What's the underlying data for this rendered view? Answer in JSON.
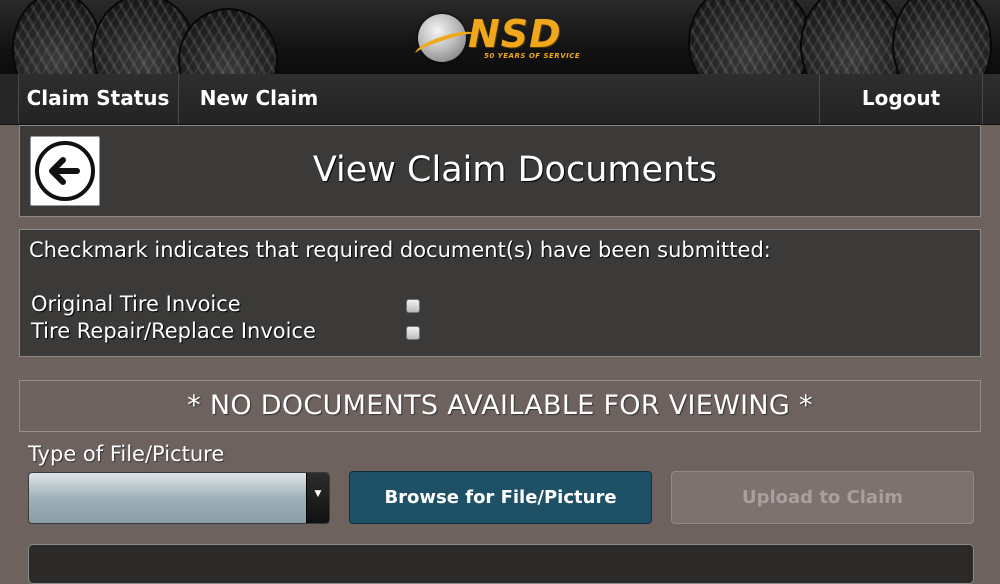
{
  "header": {
    "logo_text": "NSD",
    "logo_tagline": "50 YEARS OF SERVICE"
  },
  "nav": {
    "claim_status": "Claim Status",
    "new_claim": "New Claim",
    "logout": "Logout"
  },
  "page": {
    "title": "View Claim Documents",
    "back_icon": "arrow-left-circle-icon"
  },
  "documents": {
    "intro": "Checkmark indicates that required document(s) have been submitted:",
    "items": [
      {
        "label": "Original Tire Invoice",
        "checked": false
      },
      {
        "label": "Tire Repair/Replace Invoice",
        "checked": false
      }
    ]
  },
  "notice": "* NO DOCUMENTS AVAILABLE FOR VIEWING *",
  "upload": {
    "file_type_label": "Type of File/Picture",
    "file_type_selected": "",
    "browse_label": "Browse for File/Picture",
    "upload_label": "Upload to Claim"
  },
  "colors": {
    "page_bg": "#6e625f",
    "panel_bg": "#3b3a38",
    "brand_orange": "#f0a81a",
    "browse_button": "#1f5166"
  }
}
